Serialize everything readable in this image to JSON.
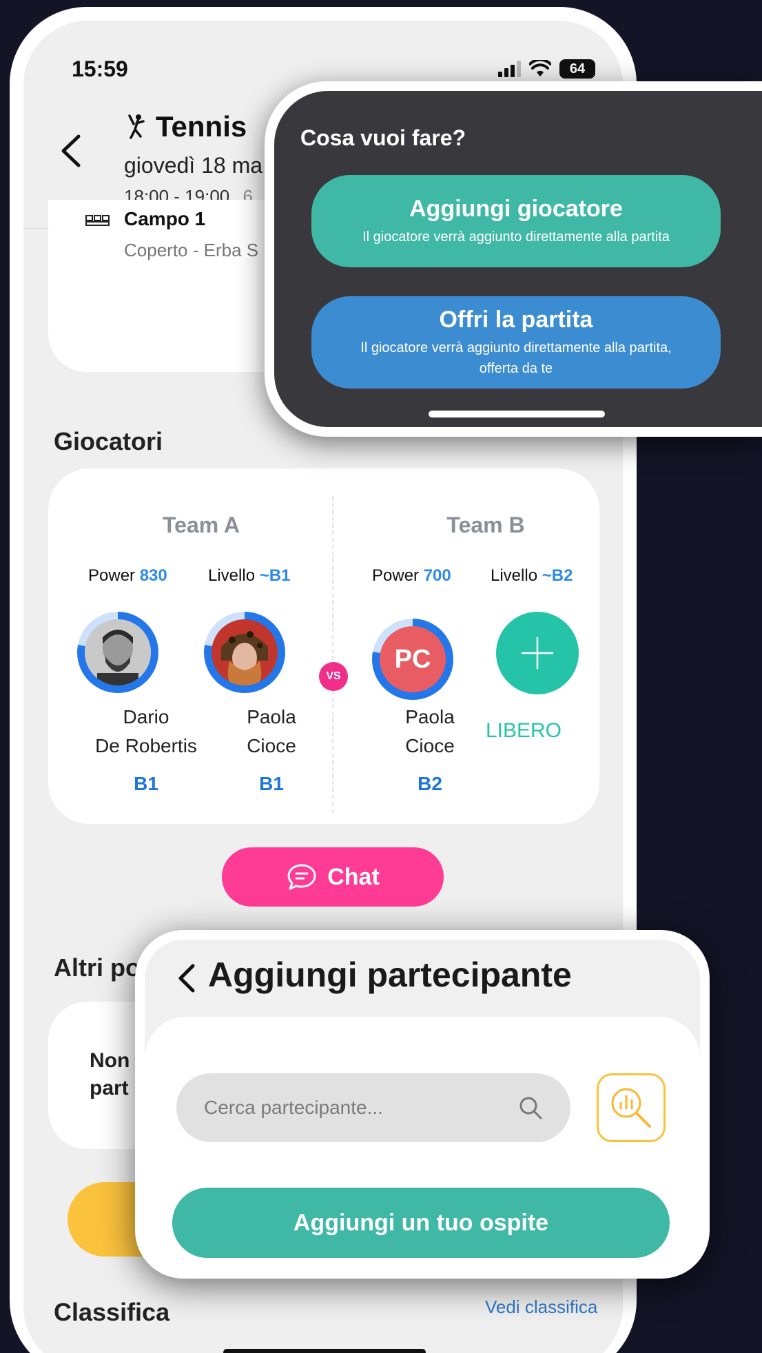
{
  "status_bar": {
    "time": "15:59",
    "battery": "64"
  },
  "header": {
    "sport_icon": "tennis-player-icon",
    "title": "Tennis",
    "date": "giovedì 18 ma",
    "time_range": "18:00 - 19:00",
    "time_extra": "6"
  },
  "court": {
    "name": "Campo 1",
    "details": "Coperto - Erba  S"
  },
  "players_section": {
    "title": "Giocatori",
    "team_a": {
      "name": "Team A",
      "power_label": "Power",
      "power_value": "830",
      "level_label": "Livello",
      "level_value": "~B1",
      "players": [
        {
          "first": "Dario",
          "last": "De Robertis",
          "level": "B1"
        },
        {
          "first": "Paola",
          "last": "Cioce",
          "level": "B1"
        }
      ]
    },
    "vs": "VS",
    "team_b": {
      "name": "Team B",
      "power_label": "Power",
      "power_value": "700",
      "level_label": "Livello",
      "level_value": "~B2",
      "players": [
        {
          "initials": "PC",
          "first": "Paola",
          "last": "Cioce",
          "level": "B2"
        }
      ],
      "free_slot_label": "LIBERO"
    }
  },
  "chat_button": "Chat",
  "others_section": {
    "title": "Altri po",
    "text_line1": "Non",
    "text_line2": "part"
  },
  "ranking_section": {
    "title": "Classifica",
    "link": "Vedi classifica"
  },
  "choice_popup": {
    "title": "Cosa vuoi fare?",
    "add_player": {
      "title": "Aggiungi giocatore",
      "subtitle": "Il giocatore verrà aggiunto direttamente alla partita"
    },
    "offer_match": {
      "title": "Offri la partita",
      "subtitle": "Il giocatore verrà aggiunto direttamente alla partita, offerta da te"
    }
  },
  "add_participant_popup": {
    "title": "Aggiungi partecipante",
    "search_placeholder": "Cerca partecipante...",
    "guest_button": "Aggiungi un tuo ospite"
  },
  "colors": {
    "teal": "#3fb8a6",
    "blue": "#3c8cd1",
    "pink": "#ff3c95",
    "yellow": "#fbc23d",
    "level_blue": "#1d74e0",
    "libero_green": "#25c4a8"
  }
}
